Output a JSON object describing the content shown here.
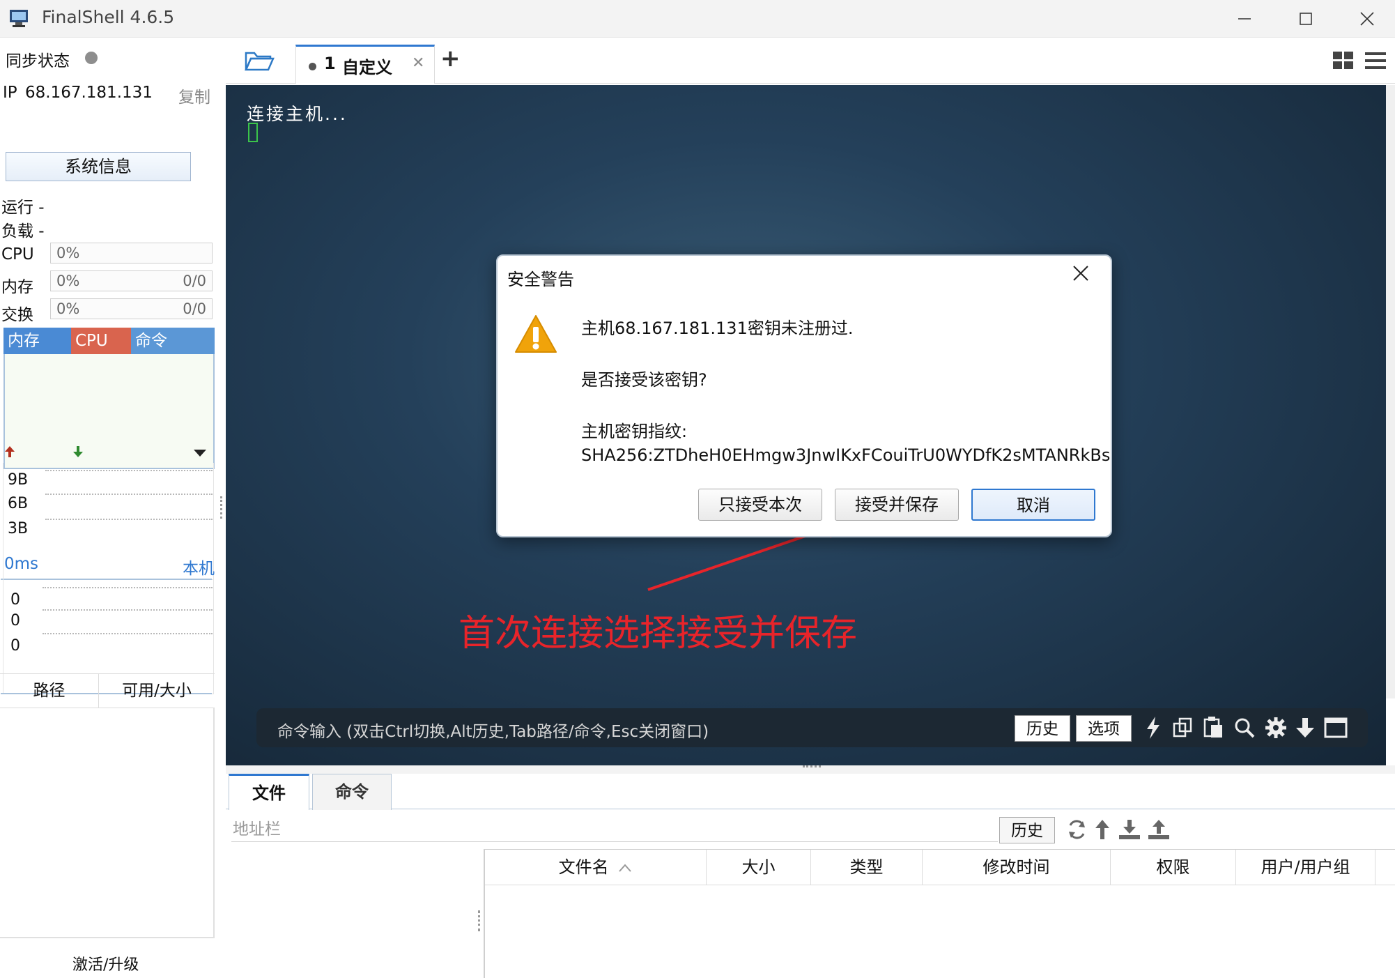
{
  "window": {
    "title": "FinalShell 4.6.5"
  },
  "left_panel": {
    "sync_label": "同步状态",
    "ip_label": "IP",
    "ip_value": "68.167.181.131",
    "copy_label": "复制",
    "sysinfo_button": "系统信息",
    "run_label": "运行 -",
    "load_label": "负载 -",
    "cpu_label": "CPU",
    "cpu_value": "0%",
    "mem_label": "内存",
    "mem_value": "0%",
    "mem_total": "0/0",
    "swap_label": "交换",
    "swap_value": "0%",
    "swap_total": "0/0",
    "proc_headers": [
      "内存",
      "CPU",
      "命令"
    ],
    "net_ticks": [
      "9B",
      "6B",
      "3B"
    ],
    "latency_label": "0ms",
    "latency_host": "本机",
    "latency_ticks": [
      "0",
      "0",
      "0"
    ],
    "path_header": "路径",
    "size_header": "可用/大小",
    "activate_label": "激活/升级"
  },
  "tabs": {
    "active_tab_number": "1",
    "active_tab_label": "自定义",
    "close_glyph": "✕",
    "add_glyph": "+"
  },
  "terminal": {
    "line1": "连接主机...",
    "annotation": "首次连接选择接受并保存",
    "annotation_color": "#e8242a"
  },
  "command_bar": {
    "placeholder": "命令输入 (双击Ctrl切换,Alt历史,Tab路径/命令,Esc关闭窗口)",
    "history_button": "历史",
    "options_button": "选项"
  },
  "dialog": {
    "title": "安全警告",
    "line1": "主机68.167.181.131密钥未注册过.",
    "line2": "是否接受该密钥?",
    "line3": "主机密钥指纹:",
    "fingerprint": "SHA256:ZTDheH0EHmgw3JnwIKxFCouiTrU0WYDfK2sMTANRkBs",
    "btn_accept_once": "只接受本次",
    "btn_accept_save": "接受并保存",
    "btn_cancel": "取消"
  },
  "file_browser": {
    "tab_files": "文件",
    "tab_commands": "命令",
    "address_placeholder": "地址栏",
    "history_button": "历史",
    "columns": [
      "文件名",
      "大小",
      "类型",
      "修改时间",
      "权限",
      "用户/用户组"
    ]
  },
  "colors": {
    "accent_blue": "#2f78d0",
    "proc_mem": "#4a8ad4",
    "proc_cpu": "#d9644e",
    "proc_cmd": "#5b97d6",
    "warning": "#f0a30a"
  }
}
